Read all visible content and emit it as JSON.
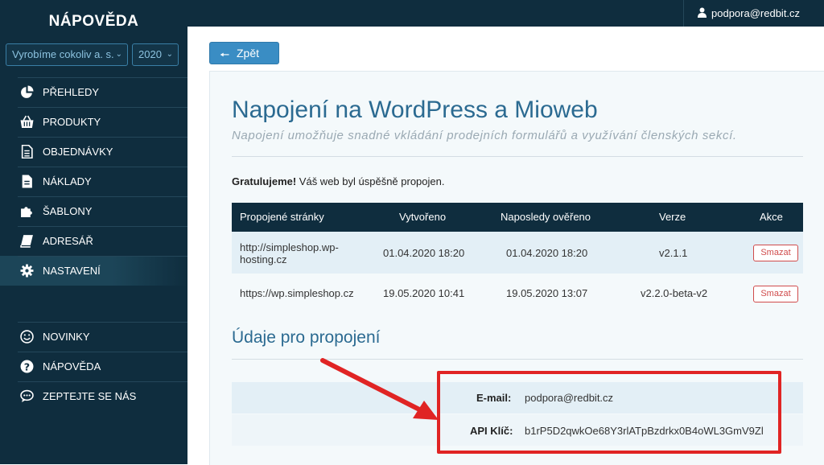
{
  "sidebar": {
    "brand": "NÁPOVĚDA",
    "company_select": "Vyrobíme cokoliv a. s.",
    "year_select": "2020",
    "items": [
      {
        "label": "PŘEHLEDY",
        "icon": "pie-chart-icon"
      },
      {
        "label": "PRODUKTY",
        "icon": "basket-icon"
      },
      {
        "label": "OBJEDNÁVKY",
        "icon": "document-icon"
      },
      {
        "label": "NÁKLADY",
        "icon": "file-icon"
      },
      {
        "label": "ŠABLONY",
        "icon": "puzzle-icon"
      },
      {
        "label": "ADRESÁŘ",
        "icon": "book-icon"
      },
      {
        "label": "NASTAVENÍ",
        "icon": "gear-icon",
        "active": true
      }
    ],
    "bottom_items": [
      {
        "label": "NOVINKY",
        "icon": "smiley-icon"
      },
      {
        "label": "NÁPOVĚDA",
        "icon": "question-icon"
      },
      {
        "label": "ZEPTEJTE SE NÁS",
        "icon": "chat-icon"
      }
    ]
  },
  "topbar": {
    "user_email": "podpora@redbit.cz",
    "user_icon": "user-icon"
  },
  "main": {
    "back_label": "Zpět",
    "title": "Napojení na WordPress a Mioweb",
    "subtitle": "Napojení umožňuje snadné vkládání prodejních formulářů a využívání členských sekcí.",
    "success_bold": "Gratulujeme!",
    "success_text": " Váš web byl úspěšně propojen.",
    "table": {
      "headers": [
        "Propojené stránky",
        "Vytvořeno",
        "Naposledy ověřeno",
        "Verze",
        "Akce"
      ],
      "rows": [
        {
          "site_line1": "http://simpleshop.wp-",
          "site_line2": "hosting.cz",
          "created": "01.04.2020 18:20",
          "verified": "01.04.2020 18:20",
          "version": "v2.1.1",
          "action": "Smazat"
        },
        {
          "site_line1": "https://wp.simpleshop.cz",
          "site_line2": "",
          "created": "19.05.2020 10:41",
          "verified": "19.05.2020 13:07",
          "version": "v2.2.0-beta-v2",
          "action": "Smazat"
        }
      ]
    },
    "credentials_title": "Údaje pro propojení",
    "email_label": "E-mail:",
    "email_value": "podpora@redbit.cz",
    "api_label": "API Klíč:",
    "api_value": "b1rP5D2qwkOe68Y3rlATpBzdrkx0B4oWL3GmV9Zl"
  },
  "colors": {
    "sidebar_bg": "#0f2d3e",
    "accent": "#2b6a91",
    "button_blue": "#3a8dc4",
    "danger": "#d04b4b",
    "highlight_box": "#e02424",
    "row_tint": "#e3eff6"
  }
}
